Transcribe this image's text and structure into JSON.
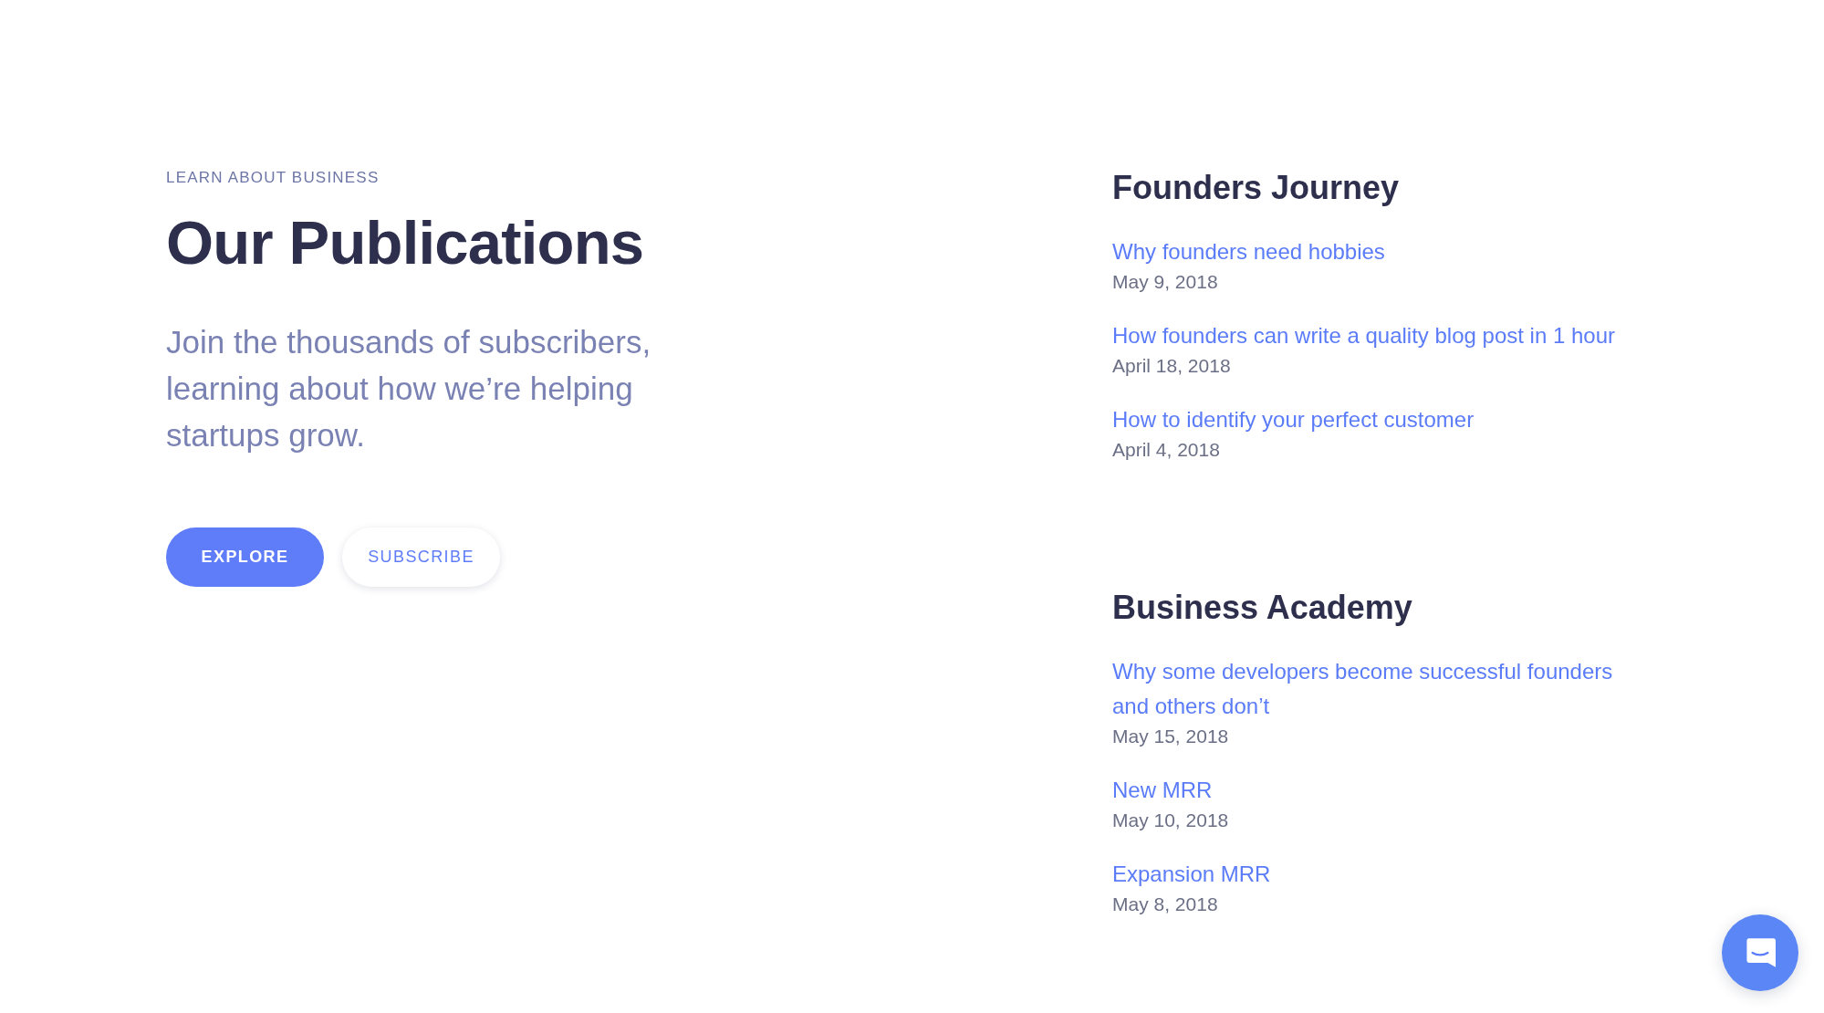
{
  "hero": {
    "eyebrow": "LEARN ABOUT BUSINESS",
    "title": "Our Publications",
    "description": "Join the thousands of subscribers, learning about how we’re helping startups grow.",
    "buttons": [
      {
        "label": "EXPLORE",
        "kind": "primary"
      },
      {
        "label": "SUBSCRIBE",
        "kind": "secondary"
      }
    ]
  },
  "sections": [
    {
      "title": "Founders Journey",
      "posts": [
        {
          "title": "Why founders need hobbies",
          "date": "May 9, 2018"
        },
        {
          "title": "How founders can write a quality blog post in 1 hour",
          "date": "April 18, 2018"
        },
        {
          "title": "How to identify your perfect customer",
          "date": "April 4, 2018"
        }
      ]
    },
    {
      "title": "Business Academy",
      "posts": [
        {
          "title": "Why some developers become successful founders and others don’t",
          "date": "May 15, 2018"
        },
        {
          "title": "New MRR",
          "date": "May 10, 2018"
        },
        {
          "title": "Expansion MRR",
          "date": "May 8, 2018"
        }
      ]
    }
  ]
}
